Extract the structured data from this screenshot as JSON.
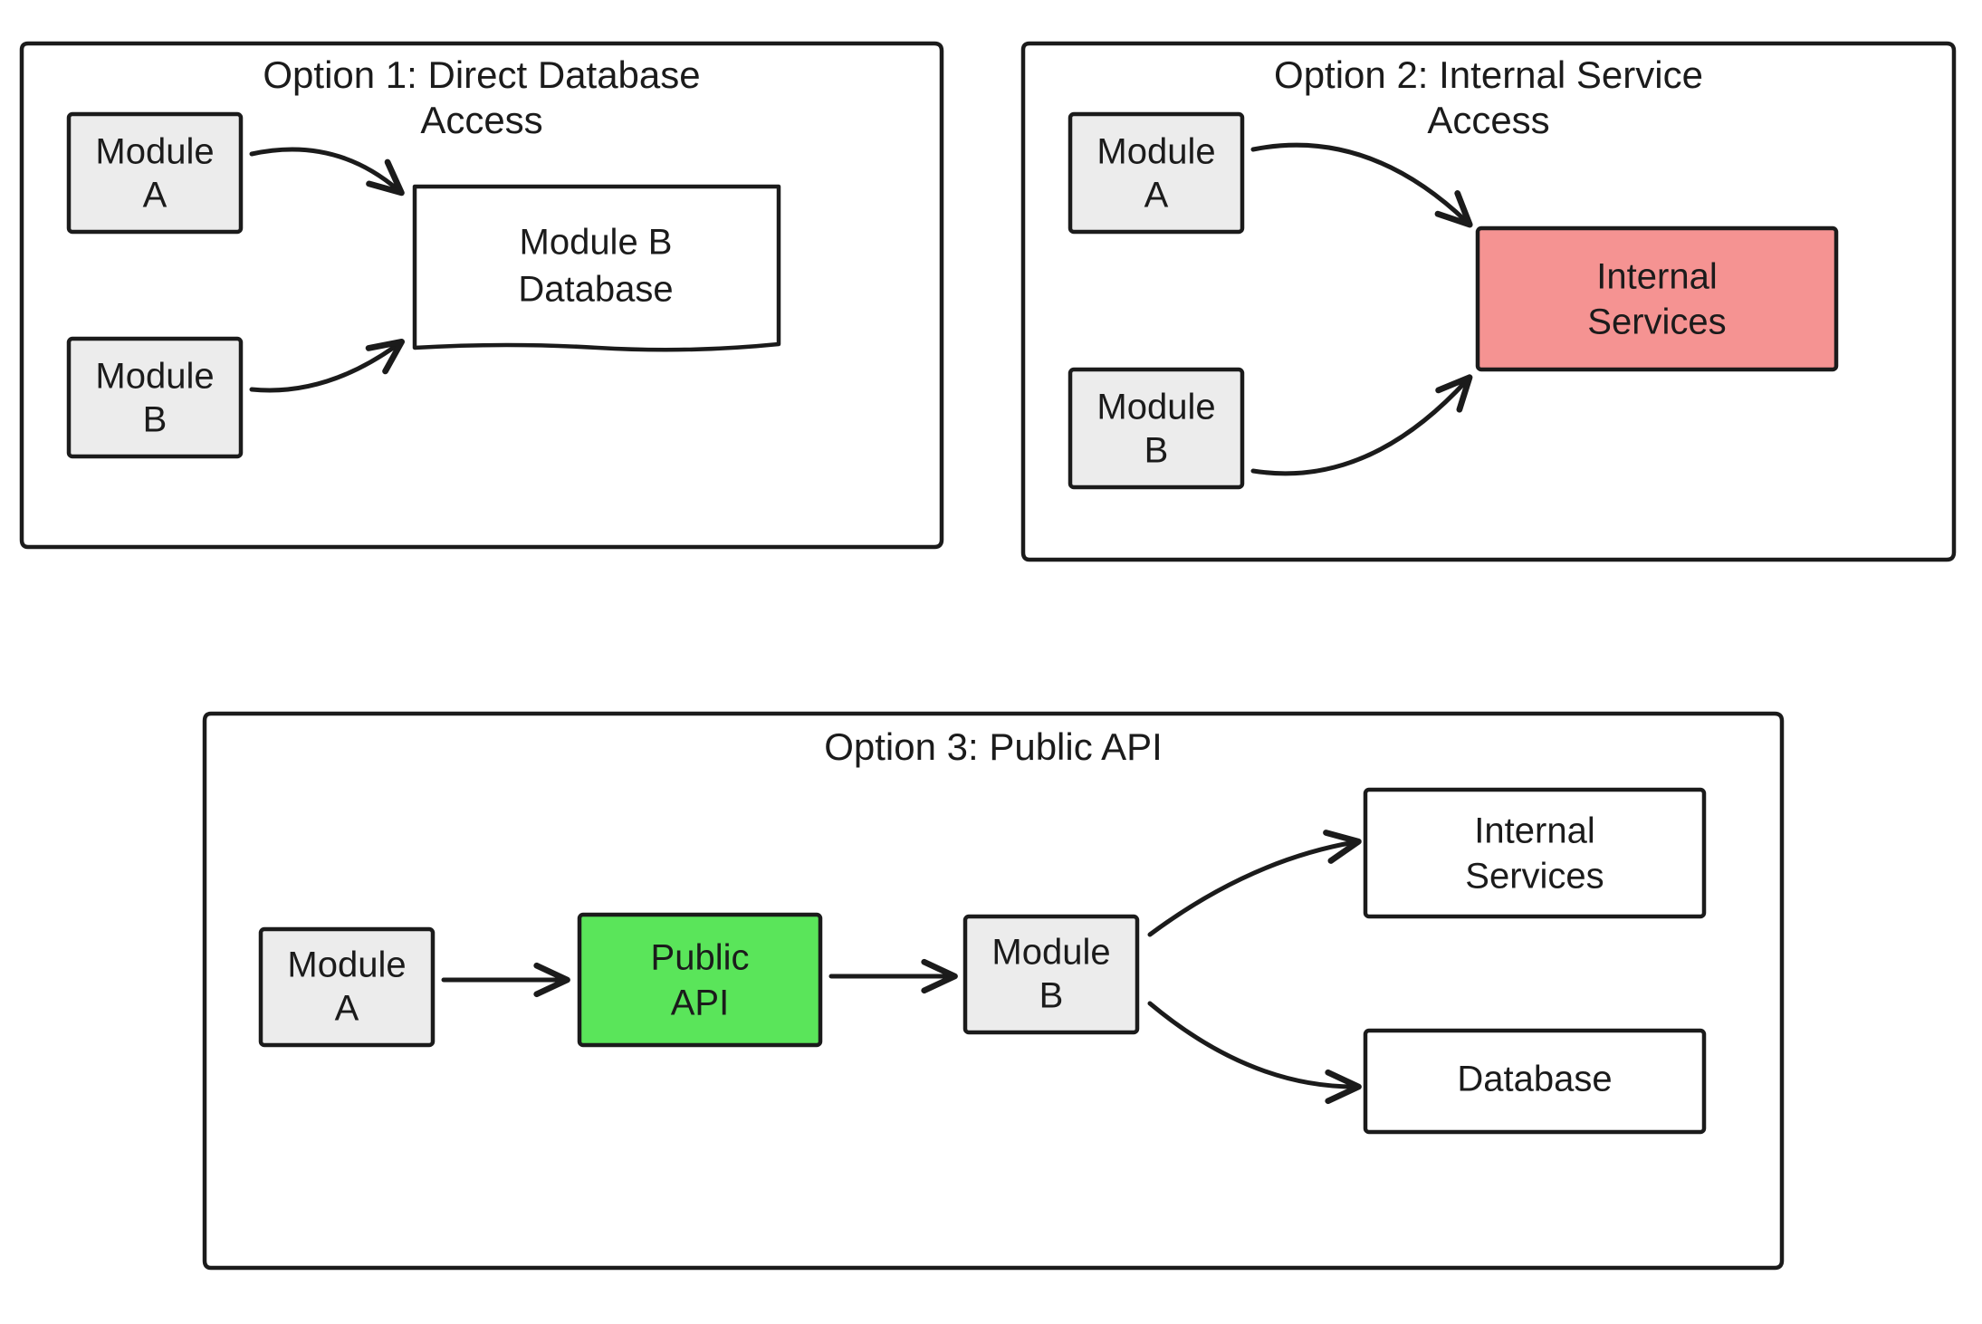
{
  "panels": {
    "option1": {
      "title_line1": "Option 1: Direct Database",
      "title_line2": "Access",
      "nodes": {
        "moduleA": {
          "line1": "Module",
          "line2": "A"
        },
        "moduleB": {
          "line1": "Module",
          "line2": "B"
        },
        "database": {
          "line1": "Module B",
          "line2": "Database"
        }
      }
    },
    "option2": {
      "title_line1": "Option 2: Internal Service",
      "title_line2": "Access",
      "nodes": {
        "moduleA": {
          "line1": "Module",
          "line2": "A"
        },
        "moduleB": {
          "line1": "Module",
          "line2": "B"
        },
        "internal": {
          "line1": "Internal",
          "line2": "Services"
        }
      }
    },
    "option3": {
      "title": "Option 3: Public API",
      "nodes": {
        "moduleA": {
          "line1": "Module",
          "line2": "A"
        },
        "publicApi": {
          "line1": "Public",
          "line2": "API"
        },
        "moduleB": {
          "line1": "Module",
          "line2": "B"
        },
        "internal": {
          "line1": "Internal",
          "line2": "Services"
        },
        "database": {
          "line1": "Database"
        }
      }
    }
  },
  "colors": {
    "gray": "#ececec",
    "white": "#ffffff",
    "red": "#f59392",
    "green": "#5ae55a",
    "stroke": "#1b1b1b"
  }
}
